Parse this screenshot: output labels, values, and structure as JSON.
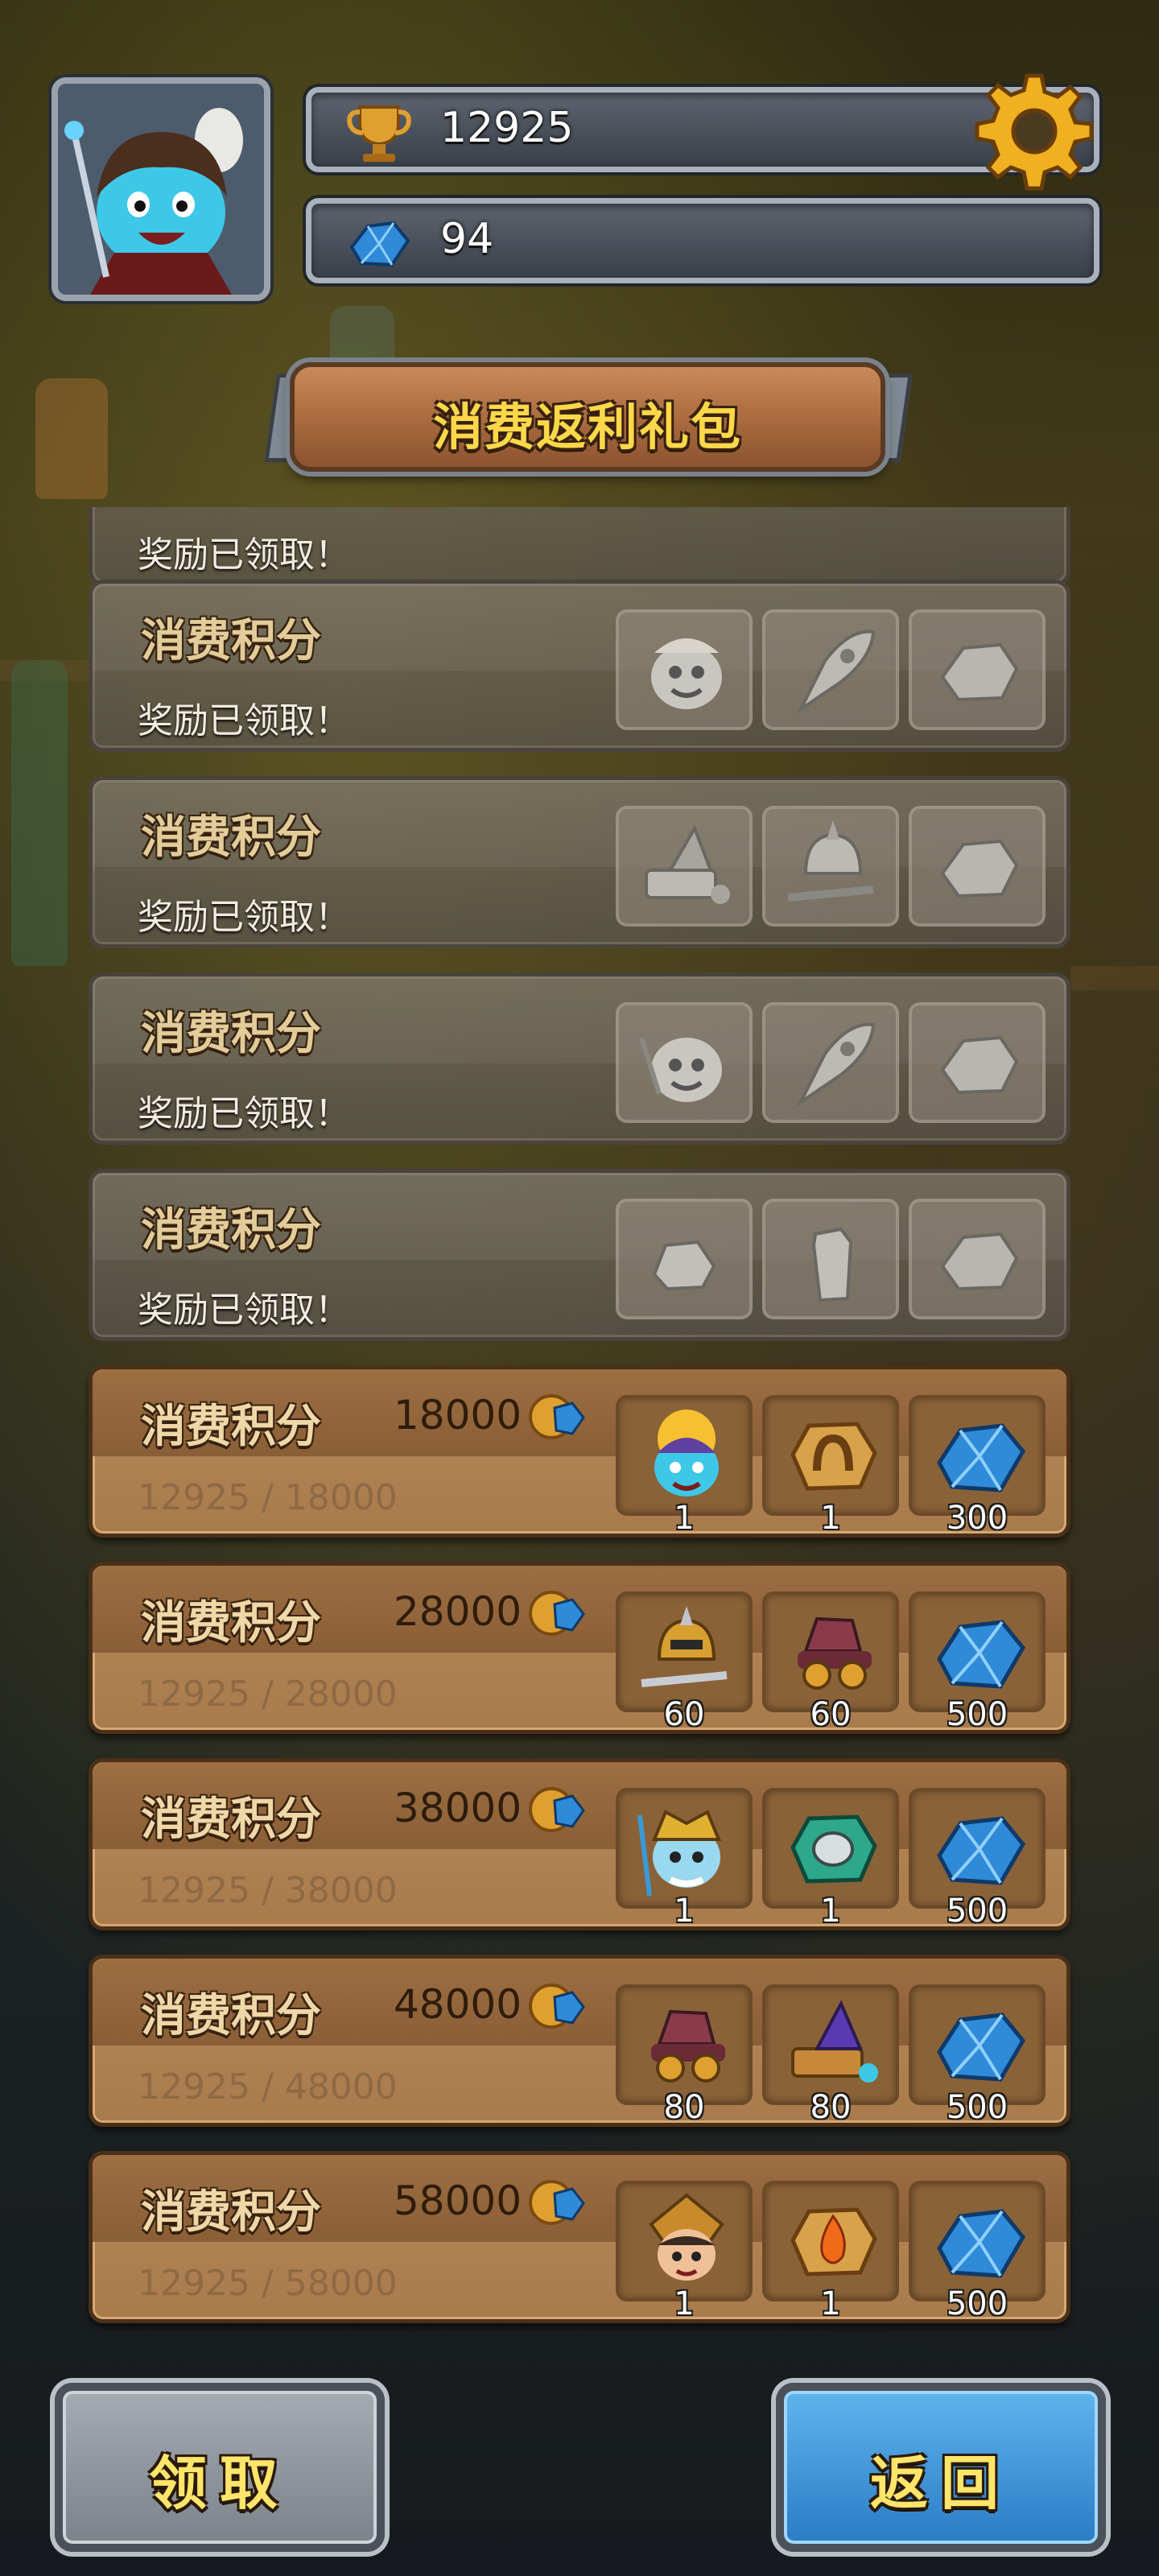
{
  "player": {
    "trophies": "12925",
    "gems": "94"
  },
  "banner": {
    "title": "消费返利礼包"
  },
  "list": {
    "partial_top_status": "奖励已领取！",
    "claimed_rows": [
      {
        "title": "消费积分",
        "status": "奖励已领取！",
        "rewards": [
          "hero-icon",
          "rocket-icon",
          "ore-icon"
        ]
      },
      {
        "title": "消费积分",
        "status": "奖励已领取！",
        "rewards": [
          "spellbook-icon",
          "helmet-sword-icon",
          "ore-icon"
        ]
      },
      {
        "title": "消费积分",
        "status": "奖励已领取！",
        "rewards": [
          "hero-icon",
          "rocket-icon",
          "ore-icon"
        ]
      },
      {
        "title": "消费积分",
        "status": "奖励已领取！",
        "rewards": [
          "stone-icon",
          "crystal-pillar-icon",
          "ore-icon"
        ]
      }
    ],
    "active_rows": [
      {
        "title": "消费积分",
        "target": "18000",
        "progress": "12925 / 18000",
        "rewards": [
          {
            "icon": "sun-hero-icon",
            "qty": "1"
          },
          {
            "icon": "horseshoe-medal-icon",
            "qty": "1"
          },
          {
            "icon": "blue-gem-icon",
            "qty": "300"
          }
        ]
      },
      {
        "title": "消费积分",
        "target": "28000",
        "progress": "12925 / 28000",
        "rewards": [
          {
            "icon": "helmet-sword-icon",
            "qty": "60"
          },
          {
            "icon": "goggles-hat-icon",
            "qty": "60"
          },
          {
            "icon": "blue-gem-icon",
            "qty": "500"
          }
        ]
      },
      {
        "title": "消费积分",
        "target": "38000",
        "progress": "12925 / 38000",
        "rewards": [
          {
            "icon": "trident-hero-icon",
            "qty": "1"
          },
          {
            "icon": "green-medal-icon",
            "qty": "1"
          },
          {
            "icon": "blue-gem-icon",
            "qty": "500"
          }
        ]
      },
      {
        "title": "消费积分",
        "target": "48000",
        "progress": "12925 / 48000",
        "rewards": [
          {
            "icon": "goggles-hat-icon",
            "qty": "80"
          },
          {
            "icon": "spellbook-icon",
            "qty": "80"
          },
          {
            "icon": "blue-gem-icon",
            "qty": "500"
          }
        ]
      },
      {
        "title": "消费积分",
        "target": "58000",
        "progress": "12925 / 58000",
        "rewards": [
          {
            "icon": "warrior-hero-icon",
            "qty": "1"
          },
          {
            "icon": "fire-medal-icon",
            "qty": "1"
          },
          {
            "icon": "blue-gem-icon",
            "qty": "500"
          }
        ]
      }
    ]
  },
  "buttons": {
    "claim": "领取",
    "back": "返回"
  },
  "colors": {
    "gold_text": "#ffd84a",
    "wood": "#a87a4c",
    "blue_button": "#2b7cc4",
    "gem_blue": "#2f8ad8"
  }
}
